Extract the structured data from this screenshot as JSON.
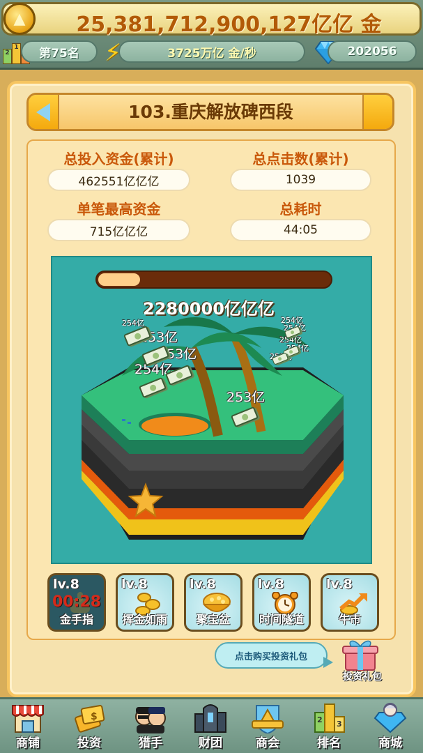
{
  "top": {
    "gold": "25,381,712,900,127亿亿 金",
    "rank": "第75名",
    "speed": "3725万亿 金/秒",
    "gems": "202056"
  },
  "level": {
    "title": "103.重庆解放碑西段"
  },
  "stats": {
    "total_invest_label": "总投入资金(累计)",
    "total_invest_value": "462551亿亿亿",
    "total_clicks_label": "总点击数(累计)",
    "total_clicks_value": "1039",
    "max_single_label": "单笔最高资金",
    "max_single_value": "715亿亿亿",
    "total_time_label": "总耗时",
    "total_time_value": "44:05"
  },
  "scene": {
    "progress": 0.18,
    "reward": "2280000亿亿亿",
    "floats": [
      "254亿",
      "253亿",
      "253亿",
      "254亿",
      "253亿",
      "254亿",
      "254亿",
      "254亿",
      "254亿",
      "256亿"
    ]
  },
  "skills": [
    {
      "level": "lv.8",
      "name": "金手指",
      "timer": "00:28",
      "icon": "golden-finger-icon"
    },
    {
      "level": "lv.8",
      "name": "挥金如雨",
      "icon": "coin-rain-icon"
    },
    {
      "level": "lv.8",
      "name": "聚宝盆",
      "icon": "treasure-bowl-icon"
    },
    {
      "level": "lv.8",
      "name": "时间隧道",
      "icon": "alarm-clock-icon"
    },
    {
      "level": "lv.8",
      "name": "牛市",
      "icon": "bull-market-arrow-icon"
    }
  ],
  "promo": {
    "bubble": "点击购买投资礼包",
    "gift_label": "投资礼包"
  },
  "nav": [
    {
      "label": "商铺",
      "icon": "shop-icon"
    },
    {
      "label": "投资",
      "icon": "invest-icon"
    },
    {
      "label": "猎手",
      "icon": "hunter-icon"
    },
    {
      "label": "财团",
      "icon": "consortium-icon"
    },
    {
      "label": "商会",
      "icon": "chamber-icon"
    },
    {
      "label": "排名",
      "icon": "ranking-icon"
    },
    {
      "label": "商城",
      "icon": "mall-icon"
    }
  ],
  "colors": {
    "accent_orange": "#c9580a",
    "scene_teal": "#34aca7",
    "gold": "#b25a07"
  }
}
